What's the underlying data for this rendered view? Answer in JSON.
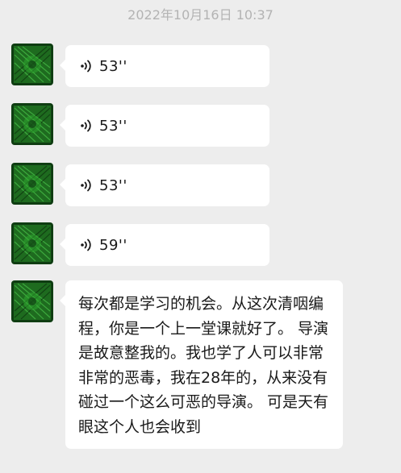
{
  "chat": {
    "timestamp": "2022年10月16日 10:37",
    "messages": [
      {
        "type": "voice",
        "duration": "53''"
      },
      {
        "type": "voice",
        "duration": "53''"
      },
      {
        "type": "voice",
        "duration": "53''"
      },
      {
        "type": "voice",
        "duration": "59''"
      },
      {
        "type": "text",
        "text": "每次都是学习的机会。从这次清咽编程，你是一个上一堂课就好了。 导演是故意整我的。我也学了人可以非常非常的恶毒，我在28年的，从来没有碰过一个这么可恶的导演。 可是天有眼这个人也会收到"
      }
    ]
  },
  "colors": {
    "background": "#ededed",
    "bubble": "#ffffff",
    "timestamp": "#b3b3b3",
    "avatar_accent": "#2fa82f"
  },
  "icons": {
    "voice": "voice-wave-icon",
    "avatar": "avatar"
  }
}
